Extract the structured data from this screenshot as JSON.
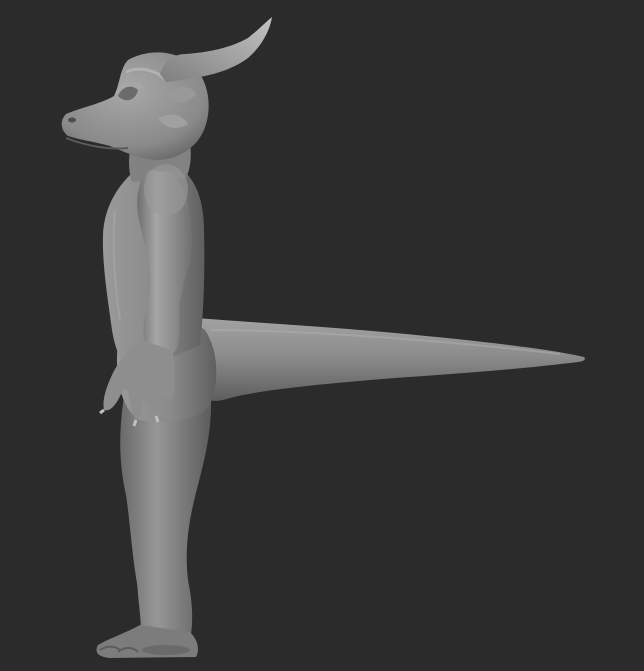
{
  "viewport": {
    "background": "#2b2b2b",
    "model_material_color": "#8a8a8a",
    "model_shadow_color": "#5a5a5a",
    "model_highlight_color": "#b4b4b4",
    "view": "side-profile",
    "subject": "dragon-character-sculpt"
  }
}
